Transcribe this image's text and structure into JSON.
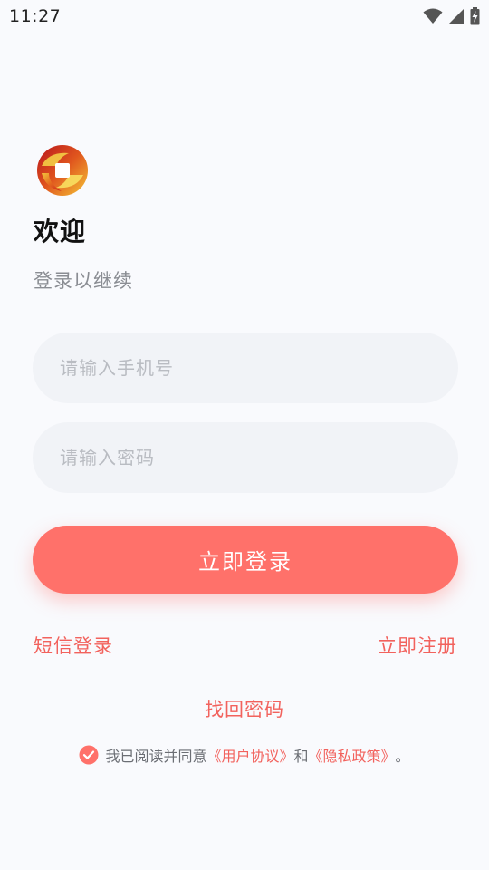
{
  "status_bar": {
    "time": "11:27",
    "icons": [
      "wifi-icon",
      "cellular-signal-icon",
      "battery-charging-icon"
    ]
  },
  "colors": {
    "accent": "#ff716a",
    "link": "#f2625d",
    "background": "#f9fafd",
    "input_background": "#f1f3f7"
  },
  "welcome": {
    "title": "欢迎",
    "subtitle": "登录以继续"
  },
  "form": {
    "phone_placeholder": "请输入手机号",
    "password_placeholder": "请输入密码",
    "login_button": "立即登录"
  },
  "links": {
    "sms_login": "短信登录",
    "register": "立即注册",
    "forgot_password": "找回密码"
  },
  "agreement": {
    "checked": true,
    "prefix": "我已阅读并同意",
    "user_agreement": "《用户协议》",
    "conjunction": "和",
    "privacy_policy": "《隐私政策》",
    "suffix": "。"
  }
}
